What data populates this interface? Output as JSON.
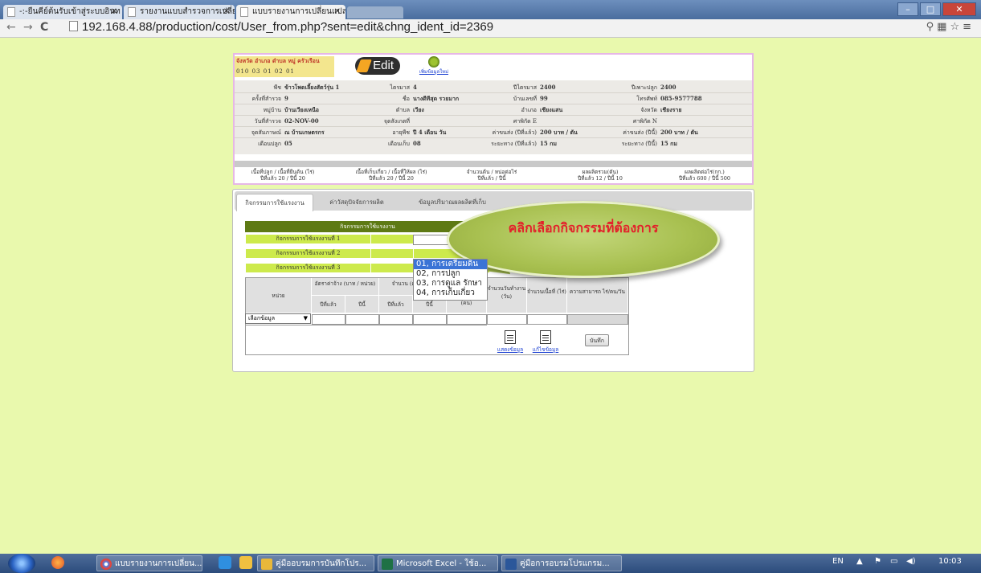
{
  "browser": {
    "tabs": [
      {
        "label": "-:-ยืนคีย์ต้นรับเข้าสู่ระบบอินท"
      },
      {
        "label": "รายงานแบบสำรวจการเปลี่ยนแ"
      },
      {
        "label": "แบบรายงานการเปลี่ยนแปลงข้"
      }
    ],
    "url": "192.168.4.88/production/cost/User_from.php?sent=edit&chng_ident_id=2369"
  },
  "header": {
    "location_label": "จังหวัด อำเภอ ตำบล  หมู่  ครัวเรือน",
    "codes": "010   03   01   02   01",
    "edit_label": "Edit",
    "add_new_label": "เพิ่มข้อมูลใหม่",
    "info": {
      "col1": [
        {
          "label": "พืช",
          "value": "ข้าวโพดเลี้ยงสัตว์รุ่น 1"
        },
        {
          "label": "ครั้งที่สำรวจ",
          "value": "9"
        },
        {
          "label": "หมู่บ้าน",
          "value": "บ้านเวียงเหนือ"
        },
        {
          "label": "วันที่สำรวจ",
          "value": "02-NOV-00"
        },
        {
          "label": "จุดสัมภาษณ์",
          "value": "ณ บ้านเกษตรกร"
        },
        {
          "label": "เดือนปลูก",
          "value": "05"
        }
      ],
      "col2": [
        {
          "label": "ไตรมาส",
          "value": "4"
        },
        {
          "label": "ชื่อ",
          "value": "นางดีทีสุด รวยมาก"
        },
        {
          "label": "ตำบล",
          "value": "เวียง"
        },
        {
          "label": "จุดสังเกตที่",
          "value": ""
        },
        {
          "label": "อายุพืช",
          "value": "ปี 4 เดือน วัน"
        },
        {
          "label": "เดือนเก็บ",
          "value": "08"
        }
      ],
      "col3": [
        {
          "label": "ปีไตรมาส",
          "value": "2400"
        },
        {
          "label": "บ้านเลขที่",
          "value": "99"
        },
        {
          "label": "อำเภอ",
          "value": "เชียงแสน"
        },
        {
          "label": "ศาพิกัด E",
          "value": ""
        },
        {
          "label": "ค่าขนส่ง (ปีที่แล้ว)",
          "value": "200 บาท / ตัน"
        },
        {
          "label": "ระยะทาง (ปีที่แล้ว)",
          "value": "15 กม"
        }
      ],
      "col4": [
        {
          "label": "ปีเพาะปลูก",
          "value": "2400"
        },
        {
          "label": "โทรศัพท์",
          "value": "085-9577788"
        },
        {
          "label": "จังหวัด",
          "value": "เชียงราย"
        },
        {
          "label": "ศาพิกัด N",
          "value": ""
        },
        {
          "label": "ค่าขนส่ง (ปีนี้)",
          "value": "200 บาท / ตัน"
        },
        {
          "label": "ระยะทาง (ปีนี้)",
          "value": "15 กม"
        }
      ]
    },
    "stats": [
      {
        "title": "เนื้อที่ปลูก / เนื้อที่ยืนต้น (ไร่)",
        "values": "ปีที่แล้ว 20 / ปีนี้ 20"
      },
      {
        "title": "เนื้อที่เก็บเกี่ยว / เนื้อที่ให้ผล (ไร่)",
        "values": "ปีที่แล้ว 20 / ปีนี้ 20"
      },
      {
        "title": "จำนวนต้น / หน่อต่อไร่",
        "values": "ปีที่แล้ว / ปีนี้"
      },
      {
        "title": "ผลผลิตรวม(ตัน)",
        "values": "ปีที่แล้ว 12 / ปีนี้ 10"
      },
      {
        "title": "ผลผลิตต่อไร่(กก.)",
        "values": "ปีที่แล้ว 600 / ปีนี้ 500"
      }
    ]
  },
  "panel": {
    "tabs": [
      "กิจกรรมการใช้แรงงาน",
      "ค่าวัสดุปัจจัยการผลิต",
      "ข้อมูลปริมาณผลผลิตที่เก็บ"
    ],
    "activity_header": "กิจกรรมการใช้แรงงาน",
    "activities": [
      "กิจกรรมการใช้แรงงานที่ 1",
      "กิจกรรมการใช้แรงงานที่ 2",
      "กิจกรรมการใช้แรงงานที่ 3"
    ],
    "dropdown_options": [
      "01, การเตรียมดิน",
      "02, การปลูก",
      "03, การดูแล รักษา",
      "04, การเก็บเกี่ยว"
    ],
    "table": {
      "unit_header": "หน่วย",
      "wage_header": "อัตราค่าจ้าง (บาท / หน่วย)",
      "qty_header": "จำนวน (ต่อหน่วย)",
      "people_header": "(คน)",
      "days_header": "จำนวนวันทำงาน (วัน)",
      "area_header": "จำนวนเนื้อที่ (ไร่)",
      "capacity_header": "ความสามารถ ไร่/คน/วัน",
      "last_year": "ปีที่แล้ว",
      "this_year": "ปีนี้",
      "unit_select": "เลือกข้อมูล",
      "show_label": "แสดงข้อมูล",
      "edit_label": "แก้ไขข้อมูล",
      "save_label": "บันทึก"
    }
  },
  "callout": {
    "text": "คลิกเลือกกิจกรรมที่ต้องการ"
  },
  "taskbar": {
    "items": [
      "แบบรายงานการเปลี่ยน...",
      "คู่มืออบรมการบันทึกโปร...",
      "Microsoft Excel - ใช้อ...",
      "คู่มือการอบรมโปรแกรม..."
    ],
    "lang": "EN",
    "time": "10:03"
  }
}
